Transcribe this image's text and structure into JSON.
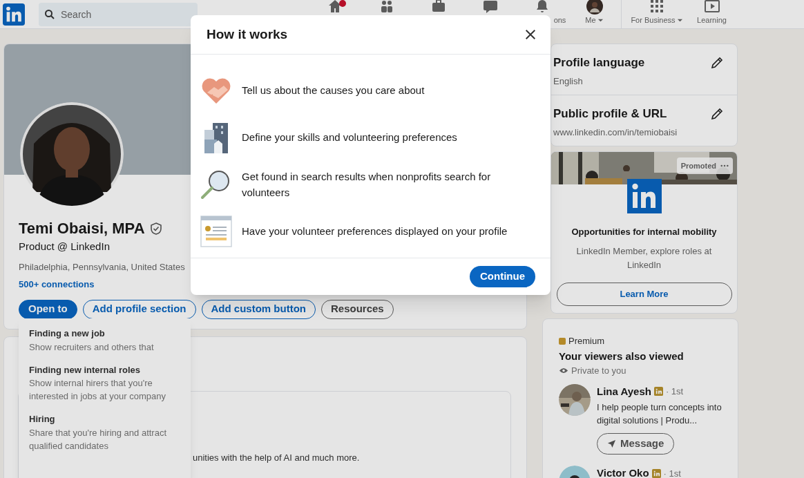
{
  "nav": {
    "search_placeholder": "Search",
    "items": [
      {
        "kind": "home",
        "badge": true
      },
      {
        "kind": "network"
      },
      {
        "kind": "jobs"
      },
      {
        "kind": "messaging"
      },
      {
        "kind": "bell",
        "label": "ons"
      },
      {
        "kind": "avatar",
        "label": "Me",
        "caret": true
      },
      {
        "kind": "grid",
        "label": "For Business",
        "caret": true
      },
      {
        "kind": "play",
        "label": "Learning"
      }
    ]
  },
  "profile": {
    "name": "Temi Obaisi, MPA",
    "verified": true,
    "headline": "Product @ LinkedIn",
    "location": "Philadelphia, Pennsylvania, United States",
    "connections": "500+ connections",
    "buttons": [
      {
        "label": "Open to",
        "kind": "primary"
      },
      {
        "label": "Add profile section",
        "kind": "outline-blue"
      },
      {
        "label": "Add custom button",
        "kind": "outline-blue"
      },
      {
        "label": "Resources",
        "kind": "outline-gray"
      }
    ]
  },
  "open_to_menu": [
    {
      "title": "Finding a new job",
      "description": "Show recruiters and others that"
    },
    {
      "title": "Finding new internal roles",
      "description": "Show internal hirers that you're interested in jobs at your company"
    },
    {
      "title": "Hiring",
      "description": "Share that you're hiring and attract qualified candidates"
    }
  ],
  "suggested": {
    "text": "unities with the help of AI and much more."
  },
  "sidebar": {
    "settings": [
      {
        "title": "Profile language",
        "value": "English"
      },
      {
        "title": "Public profile & URL",
        "value": "www.linkedin.com/in/temiobaisi"
      }
    ],
    "ad": {
      "badge": "Promoted",
      "title": "Opportunities for internal mobility",
      "body": "LinkedIn Member, explore roles at LinkedIn",
      "button": "Learn More"
    },
    "premium": {
      "label": "Premium",
      "title": "Your viewers also viewed",
      "privacy": "Private to you",
      "people": [
        {
          "name": "Lina Ayesh",
          "degree": "· 1st",
          "headline": "I help people turn concepts into digital solutions | Produ...",
          "button": "Message"
        },
        {
          "name": "Victor Oko",
          "degree": "· 1st"
        }
      ]
    }
  },
  "modal": {
    "title": "How it works",
    "steps": [
      {
        "kind": "heart",
        "text": "Tell us about the causes you care about"
      },
      {
        "kind": "buildings",
        "text": "Define your skills and volunteering preferences"
      },
      {
        "kind": "magnifier",
        "text": "Get found in search results when nonprofits search for volunteers"
      },
      {
        "kind": "profile-card",
        "text": "Have your volunteer preferences displayed on your profile"
      }
    ],
    "button": "Continue"
  }
}
